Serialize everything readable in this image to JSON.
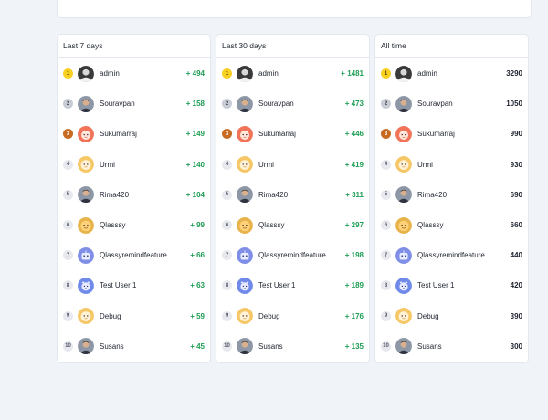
{
  "panels": [
    {
      "title": "Last 7 days",
      "rows": [
        {
          "rank": "1",
          "name": "admin",
          "score": "+ 494",
          "avatar": "photo-dark"
        },
        {
          "rank": "2",
          "name": "Souravpan",
          "score": "+ 158",
          "avatar": "photo-man"
        },
        {
          "rank": "3",
          "name": "Sukumarraj",
          "score": "+ 149",
          "avatar": "coral-face"
        },
        {
          "rank": "4",
          "name": "Urmi",
          "score": "+ 140",
          "avatar": "yellow-face"
        },
        {
          "rank": "5",
          "name": "Rima420",
          "score": "+ 104",
          "avatar": "photo-man"
        },
        {
          "rank": "6",
          "name": "Qlasssy",
          "score": "+ 99",
          "avatar": "gold-face"
        },
        {
          "rank": "7",
          "name": "Qlassyremindfeature",
          "score": "+ 66",
          "avatar": "blue-robot"
        },
        {
          "rank": "8",
          "name": "Test User 1",
          "score": "+ 63",
          "avatar": "blue-cat"
        },
        {
          "rank": "9",
          "name": "Debug",
          "score": "+ 59",
          "avatar": "yellow-face"
        },
        {
          "rank": "10",
          "name": "Susans",
          "score": "+ 45",
          "avatar": "photo-man"
        }
      ]
    },
    {
      "title": "Last 30 days",
      "rows": [
        {
          "rank": "1",
          "name": "admin",
          "score": "+ 1481",
          "avatar": "photo-dark"
        },
        {
          "rank": "2",
          "name": "Souravpan",
          "score": "+ 473",
          "avatar": "photo-man"
        },
        {
          "rank": "3",
          "name": "Sukumarraj",
          "score": "+ 446",
          "avatar": "coral-face"
        },
        {
          "rank": "4",
          "name": "Urmi",
          "score": "+ 419",
          "avatar": "yellow-face"
        },
        {
          "rank": "5",
          "name": "Rima420",
          "score": "+ 311",
          "avatar": "photo-man"
        },
        {
          "rank": "6",
          "name": "Qlasssy",
          "score": "+ 297",
          "avatar": "gold-face"
        },
        {
          "rank": "7",
          "name": "Qlassyremindfeature",
          "score": "+ 198",
          "avatar": "blue-robot"
        },
        {
          "rank": "8",
          "name": "Test User 1",
          "score": "+ 189",
          "avatar": "blue-cat"
        },
        {
          "rank": "9",
          "name": "Debug",
          "score": "+ 176",
          "avatar": "yellow-face"
        },
        {
          "rank": "10",
          "name": "Susans",
          "score": "+ 135",
          "avatar": "photo-man"
        }
      ]
    },
    {
      "title": "All time",
      "rows": [
        {
          "rank": "1",
          "name": "admin",
          "score": "3290",
          "avatar": "photo-dark"
        },
        {
          "rank": "2",
          "name": "Souravpan",
          "score": "1050",
          "avatar": "photo-man"
        },
        {
          "rank": "3",
          "name": "Sukumarraj",
          "score": "990",
          "avatar": "coral-face"
        },
        {
          "rank": "4",
          "name": "Urmi",
          "score": "930",
          "avatar": "yellow-face"
        },
        {
          "rank": "5",
          "name": "Rima420",
          "score": "690",
          "avatar": "photo-man"
        },
        {
          "rank": "6",
          "name": "Qlasssy",
          "score": "660",
          "avatar": "gold-face"
        },
        {
          "rank": "7",
          "name": "Qlassyremindfeature",
          "score": "440",
          "avatar": "blue-robot"
        },
        {
          "rank": "8",
          "name": "Test User 1",
          "score": "420",
          "avatar": "blue-cat"
        },
        {
          "rank": "9",
          "name": "Debug",
          "score": "390",
          "avatar": "yellow-face"
        },
        {
          "rank": "10",
          "name": "Susans",
          "score": "300",
          "avatar": "photo-man"
        }
      ]
    }
  ],
  "colors": {
    "positive": "#1e9e55",
    "gold": "#f7d022",
    "silver": "#c7ccd5",
    "bronze": "#c66a22",
    "page_bg": "#f0f3f8"
  }
}
